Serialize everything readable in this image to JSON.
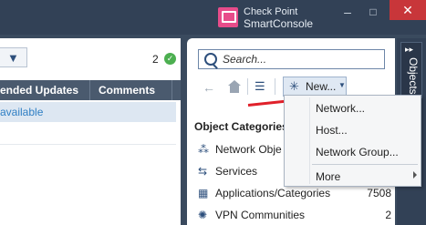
{
  "app": {
    "brand_line1": "Check Point",
    "brand_line2": "SmartConsole",
    "window_controls": {
      "minimize": "–",
      "maximize": "□",
      "close": "✕"
    }
  },
  "left_panel": {
    "filter_icon": "funnel-icon",
    "update_count": "2",
    "columns": [
      "ended Updates",
      "Comments"
    ],
    "rows": [
      {
        "status": "available"
      }
    ]
  },
  "right_panel": {
    "search_placeholder": "Search...",
    "new_button_label": "New...",
    "categories_title": "Object Categories",
    "categories": [
      {
        "icon": "network-objects-icon",
        "label": "Network Obje",
        "count": ""
      },
      {
        "icon": "services-icon",
        "label": "Services",
        "count": ""
      },
      {
        "icon": "applications-icon",
        "label": "Applications/Categories",
        "count": "7508"
      },
      {
        "icon": "vpn-icon",
        "label": "VPN Communities",
        "count": "2"
      }
    ]
  },
  "side_tab": {
    "label": "Objects"
  },
  "new_menu": {
    "items": [
      {
        "label": "Network..."
      },
      {
        "label": "Host..."
      },
      {
        "label": "Network Group..."
      },
      {
        "label": "More"
      }
    ]
  },
  "colors": {
    "title_bar": "#324156",
    "accent_link": "#2f7fc4",
    "annotation_arrow": "#e0202a"
  }
}
